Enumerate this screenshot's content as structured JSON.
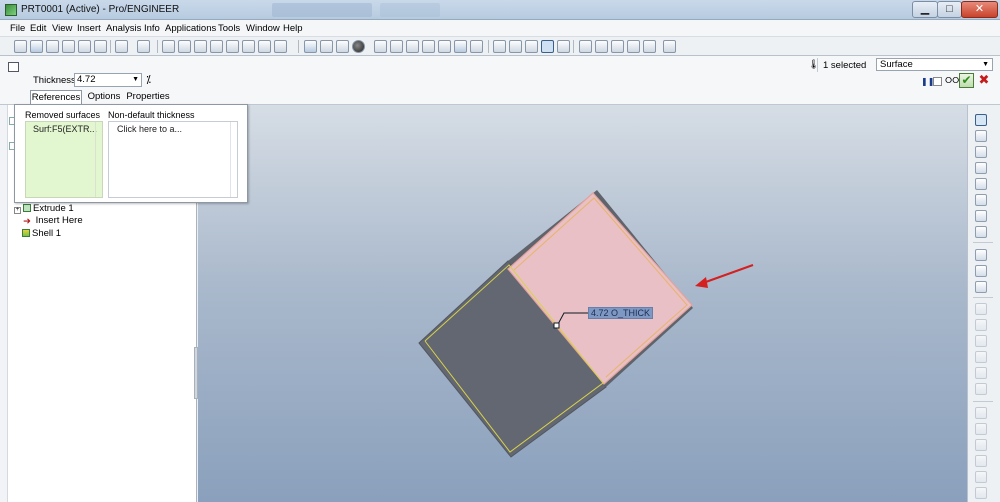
{
  "window": {
    "title": "PRT0001 (Active) - Pro/ENGINEER",
    "minimize": "▁",
    "maximize": "□",
    "close": "✕"
  },
  "menu": [
    "File",
    "Edit",
    "View",
    "Insert",
    "Analysis",
    "Info",
    "Applications",
    "Tools",
    "Window",
    "Help"
  ],
  "dashboard": {
    "thickness_label": "Thickness",
    "thickness_value": "4.72",
    "flip_symbol": "⁒",
    "tabs": [
      "References",
      "Options",
      "Properties"
    ],
    "selection_count": "1 selected",
    "filter_value": "Surface",
    "pause_symbol": "❚❚",
    "glasses_symbol": "ⵔⵔ",
    "ok_symbol": "✔",
    "cancel_symbol": "✖"
  },
  "references_panel": {
    "removed_header": "Removed surfaces",
    "removed_items": [
      "Surf:F5(EXTR..."
    ],
    "nondefault_header": "Non-default thickness",
    "nondefault_placeholder": "Click here to a..."
  },
  "model_tree": {
    "items": [
      {
        "label": "Extrude 1",
        "icon": "extrude-feature-icon"
      },
      {
        "label": "Insert Here",
        "icon": "insert-arrow-icon"
      },
      {
        "label": "Shell 1",
        "icon": "shell-feature-icon"
      }
    ]
  },
  "viewport": {
    "dimension_label": "4.72 O_THICK",
    "highlight_color": "#e8c0c6",
    "body_color": "#626771",
    "annotation_arrow_color": "#d42020"
  }
}
